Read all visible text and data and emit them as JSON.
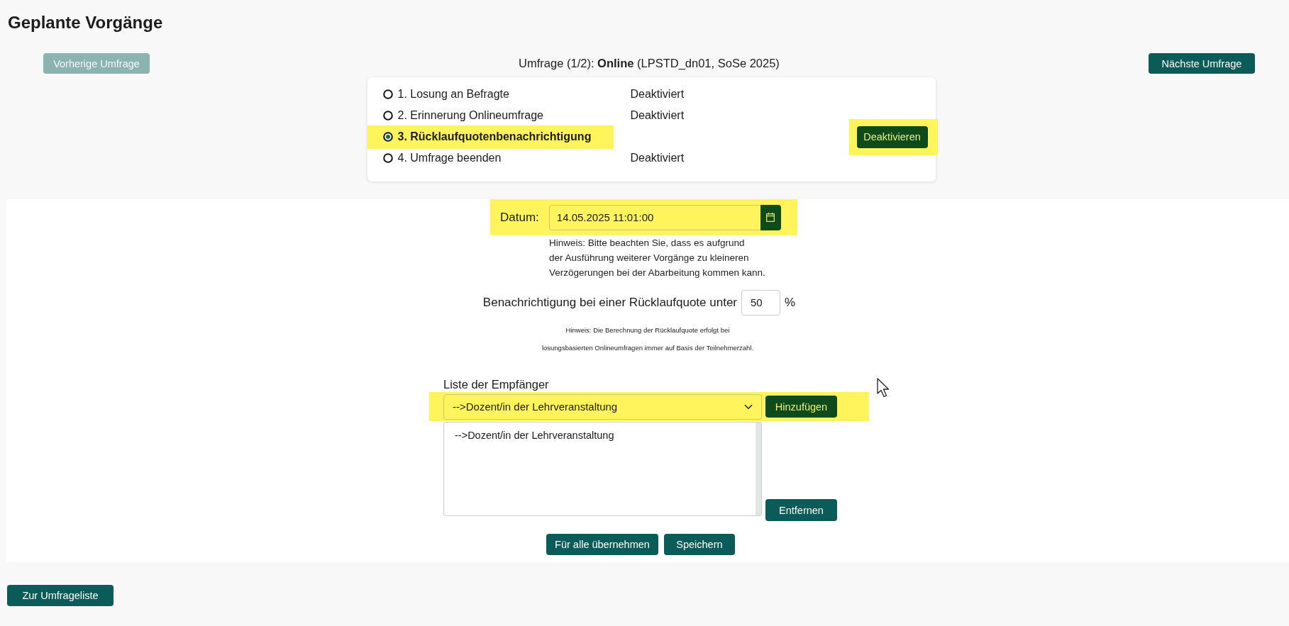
{
  "page": {
    "title": "Geplante Vorgänge"
  },
  "survey_nav": {
    "previous_button": {
      "label": "Vorherige Umfrage",
      "disabled": true
    },
    "caption": "Umfrage (1/2): **Online** (LPSTD_dn01, SoSe 2025)",
    "next_button": {
      "label": "Nächste Umfrage",
      "disabled": false
    }
  },
  "steps": [
    {
      "label": "1. Losung an Befragte",
      "status": "Deaktiviert",
      "selected": false,
      "highlighted": false
    },
    {
      "label": "2. Erinnerung Onlineumfrage",
      "status": "Deaktiviert",
      "selected": false,
      "highlighted": false
    },
    {
      "label": "3. Rücklaufquotenbenachrichtigung",
      "selected": true,
      "highlighted": true,
      "action": {
        "label": "Deaktivieren",
        "highlighted": true
      }
    },
    {
      "label": "4. Umfrage beenden",
      "status": "Deaktiviert",
      "selected": false,
      "highlighted": false
    }
  ],
  "date": {
    "label": "Datum:",
    "value": "14.05.2025 11:01:00",
    "highlighted": true,
    "hint": "Hinweis: Bitte beachten Sie, dass es aufgrund\nder Ausführung weiterer Vorgänge zu kleineren\nVerzögerungen bei der Abarbeitung kommen kann."
  },
  "threshold": {
    "label": "Benachrichtigung bei einer Rücklaufquote unter",
    "value": "50",
    "unit": "%",
    "hint": "Hinweis: Die Berechnung der Rücklaufquote erfolgt bei\nlosungsbasierten Onlineumfragen immer auf Basis der Teilnehmerzahl."
  },
  "recipients": {
    "label": "Liste der Empfänger",
    "picker": {
      "value": "-->Dozent/in der Lehrveranstaltung",
      "highlighted": true,
      "add_button": "Hinzufügen"
    },
    "items": [
      "-->Dozent/in der Lehrveranstaltung"
    ],
    "remove_button": "Entfernen"
  },
  "buttons": [
    "Für alle übernehmen",
    "Speichern"
  ],
  "back_button": "Zur Umfrageliste"
}
